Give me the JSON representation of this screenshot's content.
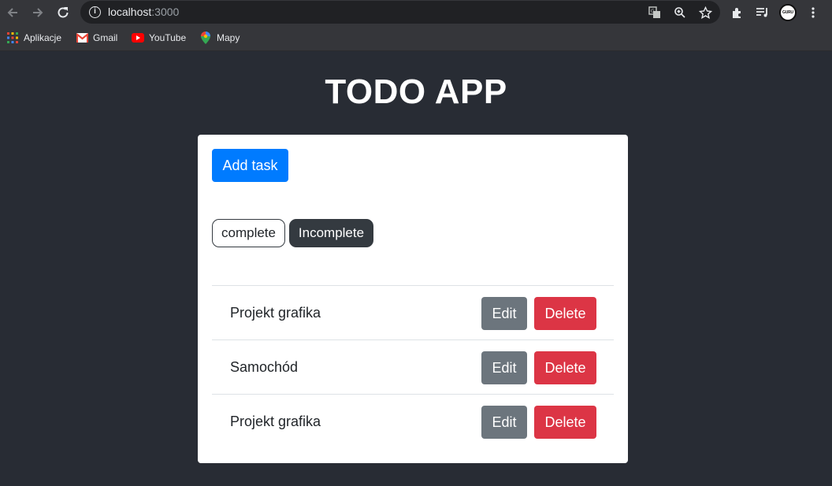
{
  "browser": {
    "url_host": "localhost",
    "url_port": ":3000",
    "profile_text": "GURU",
    "bookmarks": [
      {
        "label": "Aplikacje",
        "icon": "apps-grid-icon"
      },
      {
        "label": "Gmail",
        "icon": "gmail-icon"
      },
      {
        "label": "YouTube",
        "icon": "youtube-icon"
      },
      {
        "label": "Mapy",
        "icon": "maps-pin-icon"
      }
    ]
  },
  "app": {
    "title": "TODO APP",
    "add_task_label": "Add task",
    "filters": {
      "complete": "complete",
      "incomplete": "Incomplete",
      "active": "incomplete"
    },
    "tasks": [
      {
        "name": "Projekt grafika",
        "edit_label": "Edit",
        "delete_label": "Delete"
      },
      {
        "name": "Samochód",
        "edit_label": "Edit",
        "delete_label": "Delete"
      },
      {
        "name": "Projekt grafika",
        "edit_label": "Edit",
        "delete_label": "Delete"
      }
    ]
  },
  "colors": {
    "page_bg": "#282c34",
    "primary": "#007bff",
    "secondary": "#6c757d",
    "danger": "#dc3545",
    "dark": "#343a40"
  }
}
